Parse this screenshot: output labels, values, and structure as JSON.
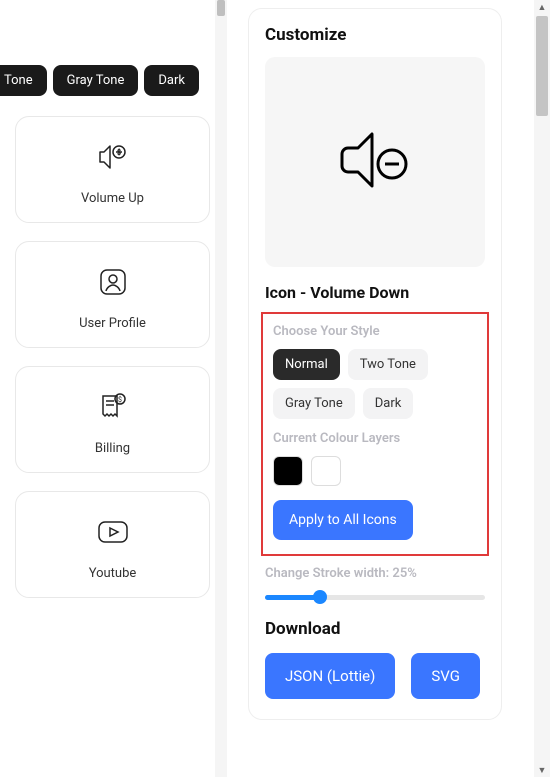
{
  "filters": {
    "tone": "Tone",
    "gray": "Gray Tone",
    "dark": "Dark"
  },
  "cards": [
    {
      "label": "Volume Up"
    },
    {
      "label": "User Profile"
    },
    {
      "label": "Billing"
    },
    {
      "label": "Youtube"
    }
  ],
  "customize": {
    "title": "Customize",
    "icon_name": "Icon - Volume Down",
    "choose_style_label": "Choose Your Style",
    "styles": {
      "normal": "Normal",
      "two_tone": "Two Tone",
      "gray": "Gray Tone",
      "dark": "Dark"
    },
    "active_style": "normal",
    "colour_layers_label": "Current Colour Layers",
    "swatches": [
      "#000000",
      "#ffffff"
    ],
    "apply_label": "Apply to All Icons",
    "stroke_label": "Change Stroke width: 25%",
    "stroke_percent": 25
  },
  "download": {
    "title": "Download",
    "json_label": "JSON (Lottie)",
    "svg_label": "SVG"
  }
}
